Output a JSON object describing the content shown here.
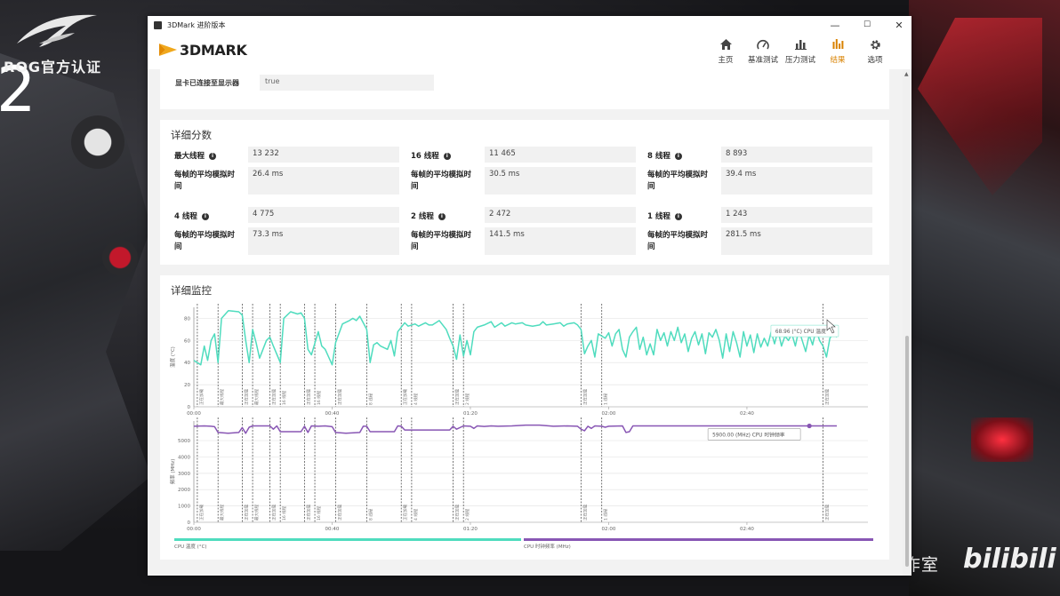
{
  "background": {
    "rog_badge": "ROG官方认证",
    "big_number": "2",
    "studio_watermark": "XCMOD工作室",
    "site_watermark": "bilibili"
  },
  "window": {
    "title": "3DMark 进阶版本",
    "controls": [
      "—",
      "☐",
      "✕"
    ]
  },
  "header": {
    "logo_text": "3DMARK",
    "nav": [
      {
        "label": "主页",
        "icon": "home-icon",
        "active": false
      },
      {
        "label": "基准测试",
        "icon": "gauge-icon",
        "active": false
      },
      {
        "label": "压力测试",
        "icon": "bar-chart-icon",
        "active": false
      },
      {
        "label": "结果",
        "icon": "results-icon",
        "active": true
      },
      {
        "label": "选项",
        "icon": "gear-icon",
        "active": false
      }
    ]
  },
  "top_row": {
    "label": "显卡已连接至显示器",
    "value": "true"
  },
  "scores": {
    "title": "详细分数",
    "frame_time_label": "每帧的平均模拟时间",
    "cells": [
      {
        "label": "最大线程",
        "score": "13 232",
        "time": "26.4 ms"
      },
      {
        "label": "16 线程",
        "score": "11 465",
        "time": "30.5 ms"
      },
      {
        "label": "8 线程",
        "score": "8 893",
        "time": "39.4 ms"
      },
      {
        "label": "4 线程",
        "score": "4 775",
        "time": "73.3 ms"
      },
      {
        "label": "2 线程",
        "score": "2 472",
        "time": "141.5 ms"
      },
      {
        "label": "1 线程",
        "score": "1 243",
        "time": "281.5 ms"
      }
    ]
  },
  "monitor": {
    "title": "详细监控",
    "legend": [
      {
        "name": "CPU 温度 (°C)",
        "color": "#4fdcbe"
      },
      {
        "name": "CPU 时钟频率 (MHz)",
        "color": "#8856b4"
      }
    ]
  },
  "chart_data": [
    {
      "type": "line",
      "ylabel": "温度 (°C)",
      "ylim": [
        0,
        90
      ],
      "yticks": [
        "0",
        "20",
        "40",
        "60",
        "80"
      ],
      "xlim": [
        0,
        195
      ],
      "xticks": [
        {
          "t": 0,
          "label": "00:00"
        },
        {
          "t": 40,
          "label": "00:40"
        },
        {
          "t": 80,
          "label": "01:20"
        },
        {
          "t": 120,
          "label": "02:00"
        },
        {
          "t": 160,
          "label": "02:40"
        }
      ],
      "color": "#4fdcbe",
      "tooltip": {
        "t": 169,
        "text": "68.96 (°C) CPU 温度"
      },
      "markers": [
        {
          "t": 1,
          "label": "正在加载"
        },
        {
          "t": 7,
          "label": "最大线程"
        },
        {
          "t": 14,
          "label": "正在加载"
        },
        {
          "t": 17,
          "label": "最大线程"
        },
        {
          "t": 22,
          "label": "正在加载"
        },
        {
          "t": 25,
          "label": "16 线程"
        },
        {
          "t": 32,
          "label": "正在加载"
        },
        {
          "t": 35,
          "label": "16 线程"
        },
        {
          "t": 41,
          "label": "正在加载"
        },
        {
          "t": 50,
          "label": "8 线程"
        },
        {
          "t": 60,
          "label": "正在加载"
        },
        {
          "t": 63,
          "label": "4 线程"
        },
        {
          "t": 75,
          "label": "正在加载"
        },
        {
          "t": 78,
          "label": "2 线程"
        },
        {
          "t": 112,
          "label": "正在加载"
        },
        {
          "t": 118,
          "label": "1 线程"
        },
        {
          "t": 182,
          "label": "正在加载"
        }
      ],
      "points": [
        [
          0,
          42
        ],
        [
          2,
          38
        ],
        [
          3,
          55
        ],
        [
          4,
          42
        ],
        [
          5,
          60
        ],
        [
          6,
          66
        ],
        [
          7,
          40
        ],
        [
          8,
          80
        ],
        [
          10,
          87
        ],
        [
          13,
          86
        ],
        [
          14,
          83
        ],
        [
          15,
          60
        ],
        [
          16,
          40
        ],
        [
          17,
          70
        ],
        [
          18,
          58
        ],
        [
          19,
          44
        ],
        [
          21,
          60
        ],
        [
          22,
          63
        ],
        [
          23,
          55
        ],
        [
          25,
          40
        ],
        [
          26,
          80
        ],
        [
          28,
          86
        ],
        [
          30,
          84
        ],
        [
          31,
          85
        ],
        [
          32,
          80
        ],
        [
          33,
          52
        ],
        [
          34,
          47
        ],
        [
          36,
          68
        ],
        [
          37,
          55
        ],
        [
          38,
          52
        ],
        [
          39,
          45
        ],
        [
          40,
          38
        ],
        [
          41,
          58
        ],
        [
          43,
          75
        ],
        [
          45,
          78
        ],
        [
          46,
          80
        ],
        [
          47,
          78
        ],
        [
          48,
          82
        ],
        [
          50,
          70
        ],
        [
          51,
          40
        ],
        [
          52,
          56
        ],
        [
          53,
          58
        ],
        [
          54,
          55
        ],
        [
          56,
          52
        ],
        [
          57,
          60
        ],
        [
          58,
          46
        ],
        [
          59,
          68
        ],
        [
          61,
          76
        ],
        [
          62,
          73
        ],
        [
          64,
          75
        ],
        [
          65,
          73
        ],
        [
          67,
          76
        ],
        [
          68,
          74
        ],
        [
          69,
          74
        ],
        [
          71,
          78
        ],
        [
          72,
          74
        ],
        [
          73,
          70
        ],
        [
          74,
          62
        ],
        [
          75,
          55
        ],
        [
          76,
          43
        ],
        [
          77,
          65
        ],
        [
          78,
          46
        ],
        [
          79,
          60
        ],
        [
          80,
          47
        ],
        [
          81,
          68
        ],
        [
          82,
          72
        ],
        [
          84,
          74
        ],
        [
          86,
          77
        ],
        [
          87,
          72
        ],
        [
          88,
          74
        ],
        [
          89,
          76
        ],
        [
          90,
          73
        ],
        [
          92,
          76
        ],
        [
          93,
          75
        ],
        [
          95,
          76
        ],
        [
          96,
          74
        ],
        [
          98,
          73
        ],
        [
          100,
          74
        ],
        [
          101,
          77
        ],
        [
          102,
          74
        ],
        [
          104,
          75
        ],
        [
          106,
          76
        ],
        [
          107,
          73
        ],
        [
          108,
          75
        ],
        [
          110,
          76
        ],
        [
          111,
          74
        ],
        [
          112,
          70
        ],
        [
          113,
          48
        ],
        [
          114,
          55
        ],
        [
          115,
          60
        ],
        [
          116,
          45
        ],
        [
          117,
          66
        ],
        [
          119,
          62
        ],
        [
          120,
          67
        ],
        [
          121,
          55
        ],
        [
          122,
          66
        ],
        [
          123,
          70
        ],
        [
          124,
          52
        ],
        [
          125,
          45
        ],
        [
          126,
          63
        ],
        [
          127,
          68
        ],
        [
          128,
          72
        ],
        [
          129,
          52
        ],
        [
          130,
          63
        ],
        [
          131,
          47
        ],
        [
          132,
          57
        ],
        [
          133,
          47
        ],
        [
          134,
          70
        ],
        [
          135,
          60
        ],
        [
          136,
          67
        ],
        [
          137,
          55
        ],
        [
          138,
          68
        ],
        [
          139,
          60
        ],
        [
          140,
          72
        ],
        [
          141,
          58
        ],
        [
          142,
          66
        ],
        [
          143,
          50
        ],
        [
          144,
          62
        ],
        [
          145,
          68
        ],
        [
          146,
          56
        ],
        [
          147,
          66
        ],
        [
          148,
          48
        ],
        [
          149,
          67
        ],
        [
          150,
          63
        ],
        [
          151,
          70
        ],
        [
          152,
          60
        ],
        [
          153,
          44
        ],
        [
          154,
          66
        ],
        [
          155,
          50
        ],
        [
          156,
          68
        ],
        [
          157,
          58
        ],
        [
          158,
          45
        ],
        [
          159,
          68
        ],
        [
          160,
          55
        ],
        [
          161,
          65
        ],
        [
          162,
          49
        ],
        [
          163,
          66
        ],
        [
          164,
          54
        ],
        [
          165,
          62
        ],
        [
          166,
          55
        ],
        [
          167,
          68
        ],
        [
          168,
          57
        ],
        [
          169,
          69
        ],
        [
          170,
          55
        ],
        [
          171,
          64
        ],
        [
          172,
          60
        ],
        [
          173,
          66
        ],
        [
          174,
          55
        ],
        [
          175,
          70
        ],
        [
          176,
          60
        ],
        [
          177,
          50
        ],
        [
          178,
          65
        ],
        [
          179,
          56
        ],
        [
          180,
          70
        ],
        [
          181,
          60
        ],
        [
          182,
          55
        ],
        [
          183,
          45
        ],
        [
          184,
          62
        ],
        [
          185,
          66
        ],
        [
          186,
          63
        ]
      ]
    },
    {
      "type": "line",
      "ylabel": "频率 (MHz)",
      "ylim": [
        0,
        6200
      ],
      "yticks": [
        "0",
        "1000",
        "2000",
        "3000",
        "4000",
        "5000"
      ],
      "xlim": [
        0,
        195
      ],
      "xticks": [
        {
          "t": 0,
          "label": "00:00"
        },
        {
          "t": 40,
          "label": "00:40"
        },
        {
          "t": 80,
          "label": "01:20"
        },
        {
          "t": 120,
          "label": "02:00"
        },
        {
          "t": 160,
          "label": "02:40"
        }
      ],
      "color": "#8856b4",
      "tooltip": {
        "t": 176,
        "text": "5900.00 (MHz) CPU 时钟频率"
      },
      "markers": [
        {
          "t": 1,
          "label": "正在加载"
        },
        {
          "t": 7,
          "label": "最大线程"
        },
        {
          "t": 14,
          "label": "正在加载"
        },
        {
          "t": 17,
          "label": "最大线程"
        },
        {
          "t": 22,
          "label": "正在加载"
        },
        {
          "t": 25,
          "label": "16 线程"
        },
        {
          "t": 32,
          "label": "正在加载"
        },
        {
          "t": 35,
          "label": "16 线程"
        },
        {
          "t": 41,
          "label": "正在加载"
        },
        {
          "t": 50,
          "label": "8 线程"
        },
        {
          "t": 60,
          "label": "正在加载"
        },
        {
          "t": 63,
          "label": "4 线程"
        },
        {
          "t": 75,
          "label": "正在加载"
        },
        {
          "t": 78,
          "label": "2 线程"
        },
        {
          "t": 112,
          "label": "正在加载"
        },
        {
          "t": 118,
          "label": "1 线程"
        },
        {
          "t": 182,
          "label": "正在加载"
        }
      ],
      "points": [
        [
          0,
          5880
        ],
        [
          3,
          5900
        ],
        [
          5,
          5880
        ],
        [
          6,
          5850
        ],
        [
          7,
          5500
        ],
        [
          10,
          5450
        ],
        [
          13,
          5500
        ],
        [
          14,
          5800
        ],
        [
          15,
          5450
        ],
        [
          16,
          5820
        ],
        [
          17,
          5900
        ],
        [
          22,
          5900
        ],
        [
          23,
          5700
        ],
        [
          24,
          5900
        ],
        [
          25,
          5550
        ],
        [
          31,
          5550
        ],
        [
          32,
          5880
        ],
        [
          33,
          5500
        ],
        [
          34,
          5900
        ],
        [
          36,
          5880
        ],
        [
          38,
          5900
        ],
        [
          40,
          5850
        ],
        [
          41,
          5500
        ],
        [
          44,
          5450
        ],
        [
          48,
          5500
        ],
        [
          49,
          5880
        ],
        [
          50,
          5880
        ],
        [
          51,
          5550
        ],
        [
          58,
          5550
        ],
        [
          59,
          5900
        ],
        [
          60,
          5880
        ],
        [
          61,
          5650
        ],
        [
          74,
          5650
        ],
        [
          75,
          5880
        ],
        [
          76,
          5700
        ],
        [
          78,
          5900
        ],
        [
          80,
          5880
        ],
        [
          81,
          5750
        ],
        [
          82,
          5900
        ],
        [
          84,
          5870
        ],
        [
          86,
          5900
        ],
        [
          88,
          5880
        ],
        [
          92,
          5900
        ],
        [
          96,
          5950
        ],
        [
          100,
          5950
        ],
        [
          104,
          5880
        ],
        [
          108,
          5900
        ],
        [
          111,
          5880
        ],
        [
          112,
          5700
        ],
        [
          113,
          5600
        ],
        [
          114,
          5880
        ],
        [
          115,
          5750
        ],
        [
          116,
          5900
        ],
        [
          118,
          5880
        ],
        [
          119,
          5820
        ],
        [
          120,
          5880
        ],
        [
          124,
          5900
        ],
        [
          125,
          5500
        ],
        [
          126,
          5550
        ],
        [
          127,
          5900
        ],
        [
          140,
          5900
        ],
        [
          141,
          5900
        ],
        [
          150,
          5900
        ],
        [
          160,
          5900
        ],
        [
          170,
          5900
        ],
        [
          176,
          5900
        ],
        [
          180,
          5900
        ],
        [
          186,
          5900
        ]
      ]
    }
  ]
}
